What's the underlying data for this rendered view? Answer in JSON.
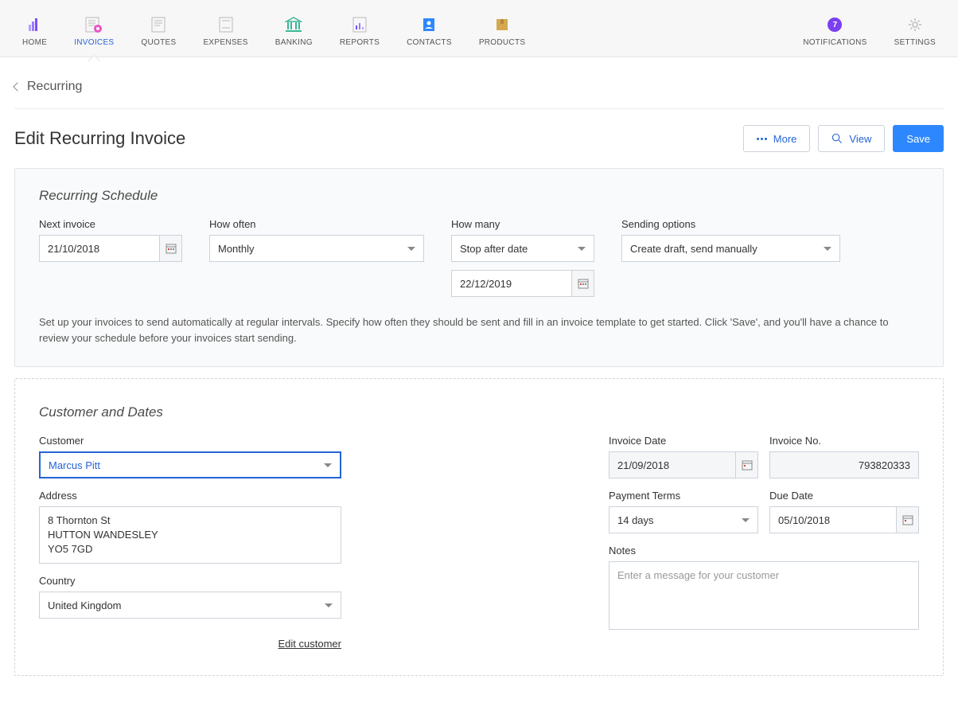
{
  "nav": {
    "items": [
      {
        "label": "HOME"
      },
      {
        "label": "INVOICES"
      },
      {
        "label": "QUOTES"
      },
      {
        "label": "EXPENSES"
      },
      {
        "label": "BANKING"
      },
      {
        "label": "REPORTS"
      },
      {
        "label": "CONTACTS"
      },
      {
        "label": "PRODUCTS"
      }
    ],
    "notifications": {
      "label": "NOTIFICATIONS",
      "count": "7"
    },
    "settings": {
      "label": "SETTINGS"
    }
  },
  "breadcrumb": "Recurring",
  "page_title": "Edit Recurring Invoice",
  "buttons": {
    "more": "More",
    "view": "View",
    "save": "Save"
  },
  "schedule": {
    "title": "Recurring Schedule",
    "next_invoice_label": "Next invoice",
    "next_invoice": "21/10/2018",
    "how_often_label": "How often",
    "how_often": "Monthly",
    "how_many_label": "How many",
    "how_many": "Stop after date",
    "stop_date": "22/12/2019",
    "sending_label": "Sending options",
    "sending": "Create draft, send manually",
    "help": "Set up your invoices to send automatically at regular intervals. Specify how often they should be sent and fill in an invoice template to get started. Click 'Save', and you'll have a chance to review your schedule before your invoices start sending."
  },
  "customer": {
    "title": "Customer and Dates",
    "customer_label": "Customer",
    "customer": "Marcus Pitt",
    "address_label": "Address",
    "address": "8 Thornton St\nHUTTON WANDESLEY\nYO5 7GD",
    "country_label": "Country",
    "country": "United Kingdom",
    "edit_link": "Edit customer",
    "invoice_date_label": "Invoice Date",
    "invoice_date": "21/09/2018",
    "invoice_no_label": "Invoice No.",
    "invoice_no": "793820333",
    "terms_label": "Payment Terms",
    "terms": "14 days",
    "due_label": "Due Date",
    "due": "05/10/2018",
    "notes_label": "Notes",
    "notes_placeholder": "Enter a message for your customer"
  }
}
